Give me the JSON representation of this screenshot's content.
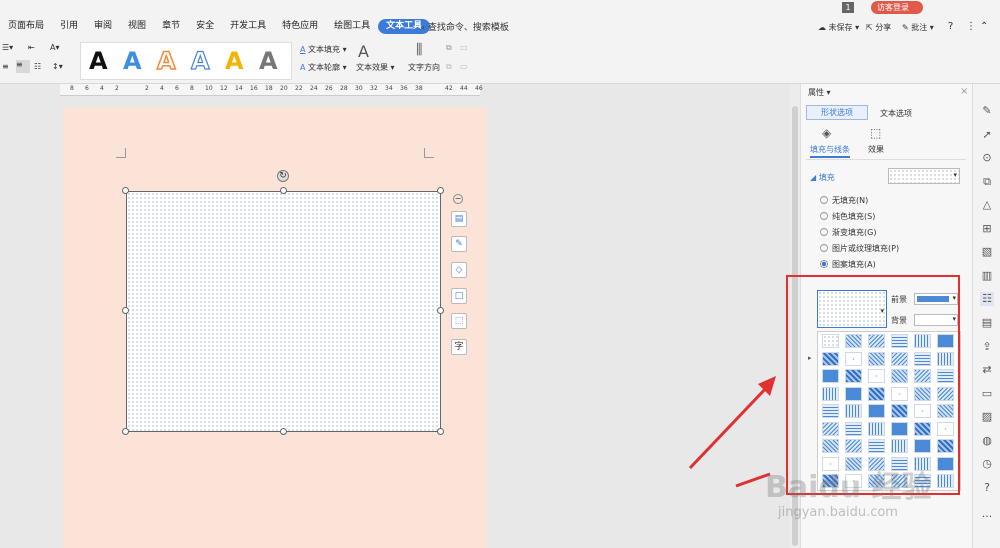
{
  "menubar": {
    "tabs": [
      "页面布局",
      "引用",
      "审阅",
      "视图",
      "章节",
      "安全",
      "开发工具",
      "特色应用",
      "绘图工具",
      "文本工具"
    ],
    "active_tab": "文本工具",
    "search": "查找命令、搜索模板",
    "page_indicator": "1",
    "login": "访客登录",
    "unsaved": "未保存",
    "share": "分享",
    "comment": "批注",
    "help": "?"
  },
  "toolbar": {
    "text_fill": "文本填充",
    "text_outline": "文本轮廓",
    "text_effect": "文本效果",
    "text_direction": "文字方向",
    "style_glyph": "A"
  },
  "ruler": {
    "ticks": [
      "8",
      "6",
      "4",
      "2",
      "2",
      "4",
      "6",
      "8",
      "10",
      "12",
      "14",
      "16",
      "18",
      "20",
      "22",
      "24",
      "26",
      "28",
      "30",
      "32",
      "34",
      "36",
      "38",
      "42",
      "44",
      "46"
    ]
  },
  "float_tools": {
    "text_char": "字"
  },
  "panel": {
    "title": "属性",
    "tab_shape": "形状选项",
    "tab_text": "文本选项",
    "sub_fill_line": "填充与线条",
    "sub_effect": "效果",
    "section_fill": "填充",
    "options": [
      "无填充(N)",
      "纯色填充(S)",
      "渐变填充(G)",
      "图片或纹理填充(P)",
      "图案填充(A)"
    ],
    "selected_option": "图案填充(A)",
    "foreground": "前景",
    "background": "背景"
  },
  "colors": {
    "accent": "#3d7bd8",
    "page": "#fbe3d7",
    "highlight_box": "#e03030",
    "login_badge": "#e05a4a",
    "style_colors": [
      "#111111",
      "#3d8ee0",
      "#f08a3c",
      "#4a86d8",
      "#f5b400",
      "#777777"
    ]
  },
  "watermark": {
    "main": "Baidu 经验",
    "url": "jingyan.baidu.com"
  }
}
